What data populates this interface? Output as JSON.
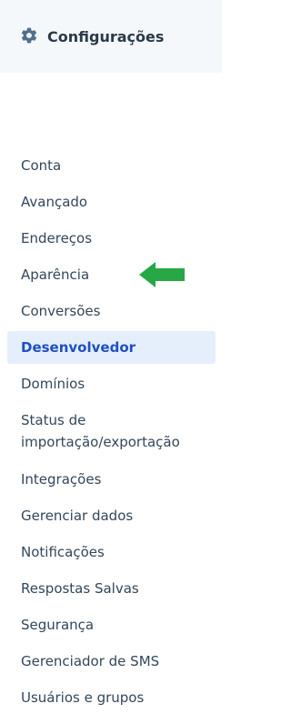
{
  "header": {
    "icon": "gear-icon",
    "title": "Configurações"
  },
  "nav": {
    "items": [
      {
        "label": "Conta"
      },
      {
        "label": "Avançado"
      },
      {
        "label": "Endereços"
      },
      {
        "label": "Aparência"
      },
      {
        "label": "Conversões"
      },
      {
        "label": "Desenvolvedor",
        "active": true
      },
      {
        "label": "Domínios"
      },
      {
        "label": "Status de importação/exportação"
      },
      {
        "label": "Integrações"
      },
      {
        "label": "Gerenciar dados"
      },
      {
        "label": "Notificações"
      },
      {
        "label": "Respostas Salvas"
      },
      {
        "label": "Segurança"
      },
      {
        "label": "Gerenciador de SMS"
      },
      {
        "label": "Usuários e grupos"
      }
    ]
  },
  "annotation": {
    "icon": "arrow-left-icon",
    "color": "#28a745"
  },
  "colors": {
    "active_bg": "#e5effb",
    "active_text": "#1f4fc2",
    "text": "#33475b",
    "header_bg": "#f5f8fb"
  }
}
